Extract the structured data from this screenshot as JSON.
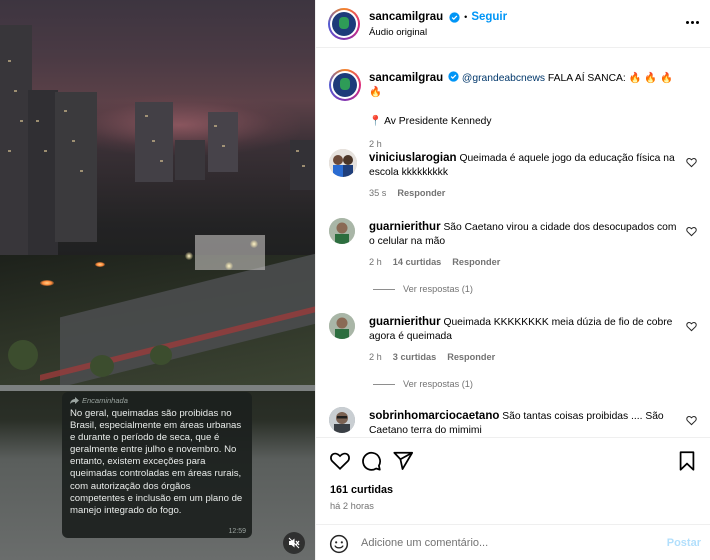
{
  "post": {
    "username": "sancamilgrau",
    "follow_label": "Seguir",
    "separator": "•",
    "audio": "Áudio original",
    "caption_mention": "@grandeabcnews",
    "caption_text": " FALA AÍ SANCA: 🔥 🔥 🔥 🔥",
    "location_line": "📍 Av Presidente Kennedy",
    "caption_time": "2 h"
  },
  "comments": [
    {
      "username": "viniciuslarogian",
      "text": "Queimada é aquele jogo da educação física na escola kkkkkkkkk",
      "time": "35 s",
      "reply_label": "Responder"
    },
    {
      "username": "guarnierithur",
      "text": "São Caetano virou a cidade dos desocupados com o celular na mão",
      "time": "2 h",
      "likes": "14 curtidas",
      "reply_label": "Responder",
      "view_replies": "Ver respostas (1)"
    },
    {
      "username": "guarnierithur",
      "text": "Queimada KKKKKKKK meia dúzia de fio de cobre agora é queimada",
      "time": "2 h",
      "likes": "3 curtidas",
      "reply_label": "Responder",
      "view_replies": "Ver respostas (1)"
    },
    {
      "username": "sobrinhomarciocaetano",
      "text": "São tantas coisas proibidas .... São Caetano terra do mimimi"
    }
  ],
  "engagement": {
    "likes": "161 curtidas",
    "time": "há 2 horas"
  },
  "composer": {
    "placeholder": "Adicione um comentário...",
    "post_label": "Postar"
  },
  "media": {
    "forwarded_label": "Encaminhada",
    "message": "No geral, queimadas são proibidas no Brasil, especialmente em áreas urbanas e durante o período de seca, que é geralmente entre julho e novembro. No entanto, existem exceções para queimadas controladas em áreas rurais, com autorização dos órgãos competentes e inclusão em um plano de manejo integrado do fogo.",
    "message_time": "12:59"
  },
  "colors": {
    "link": "#0095f6",
    "verified": "#0095f6",
    "muted": "#737373",
    "post_disabled": "#b2dffc"
  },
  "icons": [
    "verified-badge-icon",
    "more-options-icon",
    "heart-icon",
    "comment-icon",
    "share-icon",
    "bookmark-icon",
    "emoji-icon",
    "mute-icon",
    "forward-icon"
  ]
}
